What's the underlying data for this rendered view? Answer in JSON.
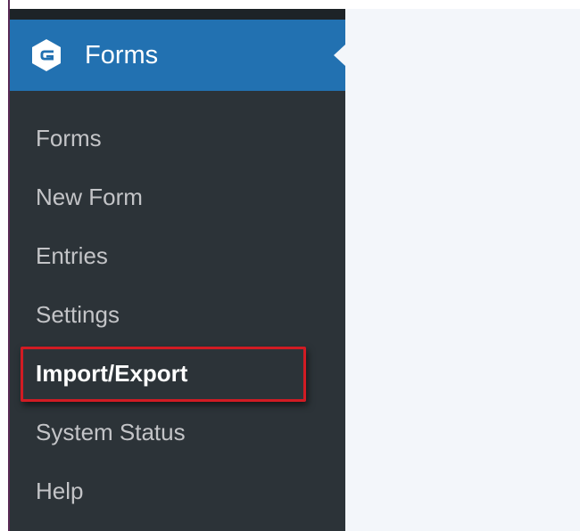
{
  "menu": {
    "header_label": "Forms",
    "logo_icon": "gravity-forms-logo-icon",
    "items": [
      {
        "label": "Forms"
      },
      {
        "label": "New Form"
      },
      {
        "label": "Entries"
      },
      {
        "label": "Settings"
      },
      {
        "label": "Import/Export",
        "current": true
      },
      {
        "label": "System Status"
      },
      {
        "label": "Help"
      }
    ]
  },
  "colors": {
    "sidebar_bg": "#2c3338",
    "header_bg": "#2271b1",
    "content_bg": "#f3f6fa",
    "highlight": "#d11b23"
  }
}
